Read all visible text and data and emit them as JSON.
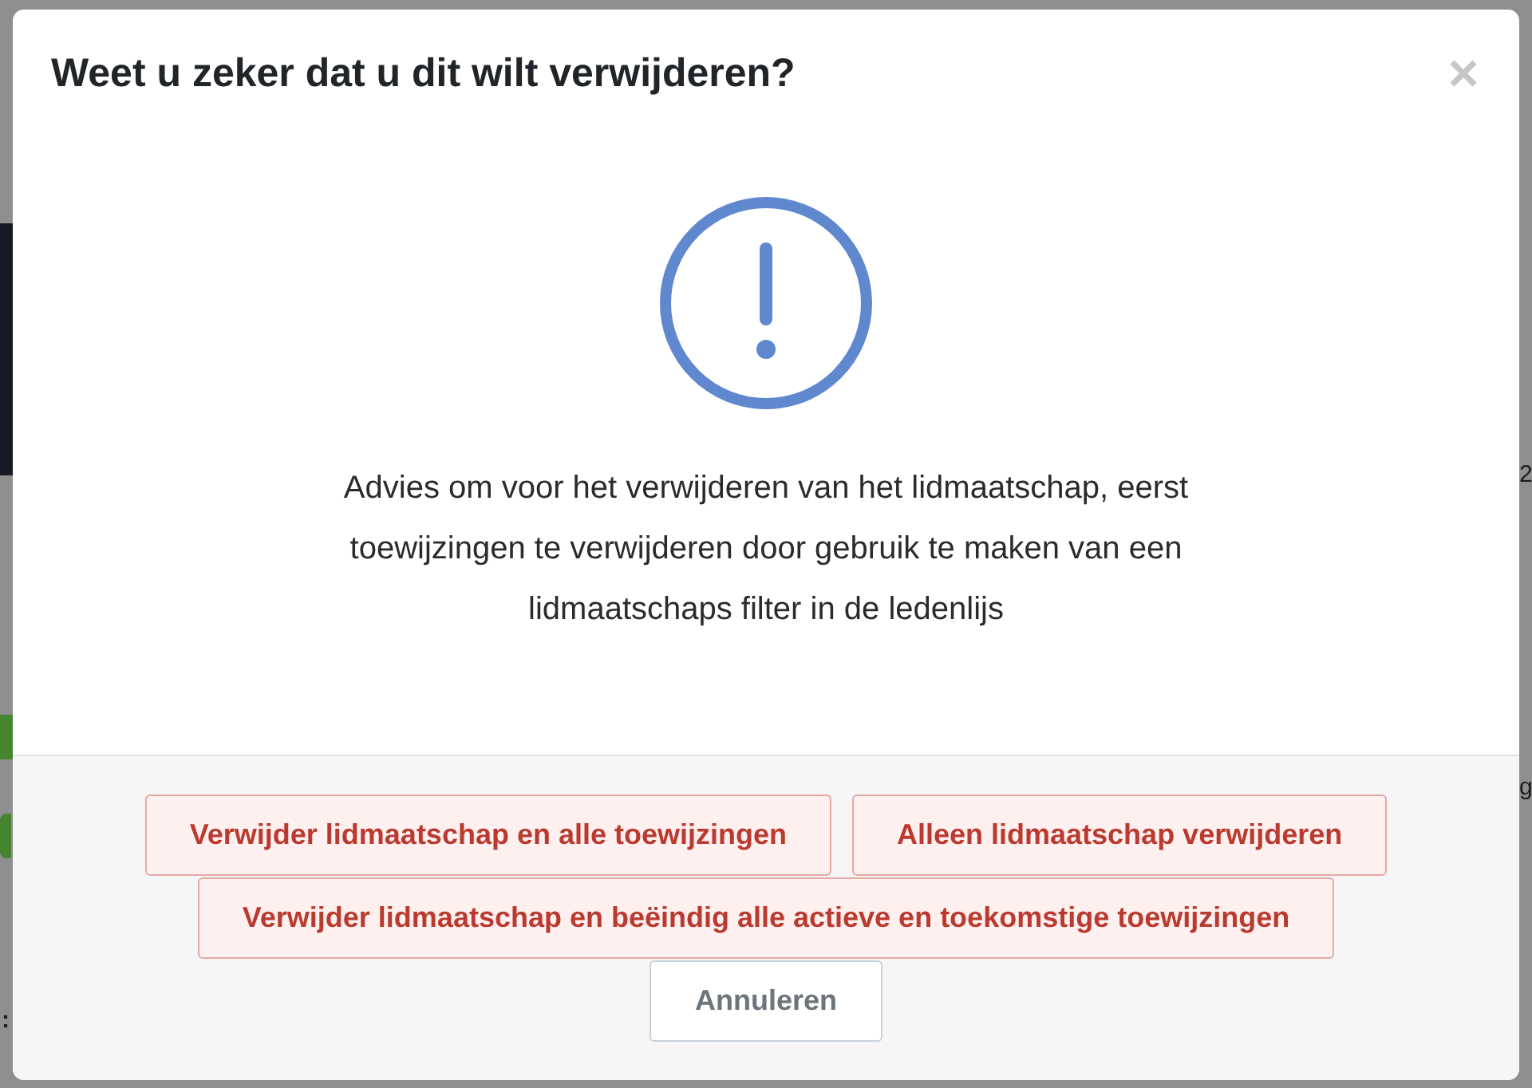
{
  "background": {
    "left_edge_texts": [
      ":"
    ],
    "right_edge_texts": [
      "2",
      "g"
    ]
  },
  "dialog": {
    "title": "Weet u zeker dat u dit wilt verwijderen?",
    "message": "Advies om voor het verwijderen van het lidmaatschap, eerst toewijzingen te verwijderen door gebruik te maken van een lidmaatschaps filter in de ledenlijs",
    "button_rows": [
      {
        "buttons": [
          {
            "label": "Verwijder lidmaatschap en alle toewijzingen",
            "kind": "danger"
          },
          {
            "label": "Alleen lidmaatschap verwijderen",
            "kind": "danger"
          }
        ]
      },
      {
        "buttons": [
          {
            "label": "Verwijder lidmaatschap en beëindig alle actieve en toekomstige toewijzingen",
            "kind": "danger"
          }
        ]
      },
      {
        "buttons": [
          {
            "label": "Annuleren",
            "kind": "cancel"
          }
        ]
      }
    ]
  }
}
